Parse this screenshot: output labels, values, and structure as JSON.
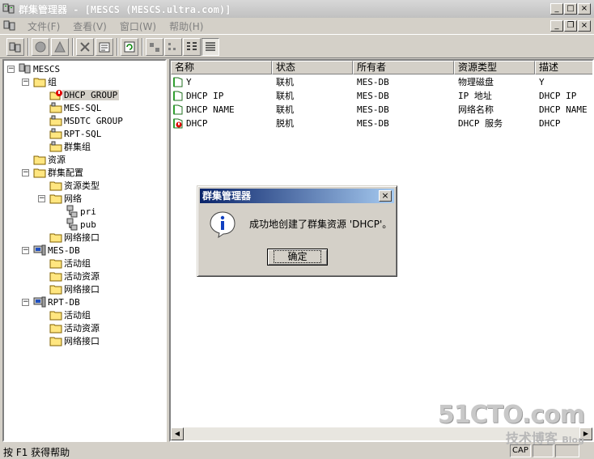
{
  "window": {
    "title": "群集管理器 - [MESCS (MESCS.ultra.com)]"
  },
  "menu": [
    "文件(F)",
    "查看(V)",
    "窗口(W)",
    "帮助(H)"
  ],
  "tree": {
    "root": "MESCS",
    "groups_label": "组",
    "groups": [
      "DHCP GROUP",
      "MES-SQL",
      "MSDTC GROUP",
      "RPT-SQL",
      "群集组"
    ],
    "resources_label": "资源",
    "cluster_config_label": "群集配置",
    "resource_types_label": "资源类型",
    "networks_label": "网络",
    "networks": [
      "pri",
      "pub"
    ],
    "network_interfaces_label": "网络接口",
    "nodes": [
      {
        "name": "MES-DB",
        "children": [
          "活动组",
          "活动资源",
          "网络接口"
        ]
      },
      {
        "name": "RPT-DB",
        "children": [
          "活动组",
          "活动资源",
          "网络接口"
        ]
      }
    ]
  },
  "list": {
    "columns": [
      "名称",
      "状态",
      "所有者",
      "资源类型",
      "描述"
    ],
    "rows": [
      {
        "name": "Y",
        "state": "联机",
        "owner": "MES-DB",
        "type": "物理磁盘",
        "desc": "Y"
      },
      {
        "name": "DHCP IP",
        "state": "联机",
        "owner": "MES-DB",
        "type": "IP 地址",
        "desc": "DHCP IP"
      },
      {
        "name": "DHCP NAME",
        "state": "联机",
        "owner": "MES-DB",
        "type": "网络名称",
        "desc": "DHCP NAME"
      },
      {
        "name": "DHCP",
        "state": "脱机",
        "owner": "MES-DB",
        "type": "DHCP 服务",
        "desc": "DHCP"
      }
    ]
  },
  "dialog": {
    "title": "群集管理器",
    "message": "成功地创建了群集资源 'DHCP'。",
    "ok_label": "确定"
  },
  "status": {
    "text": "按 F1 获得帮助",
    "cap": "CAP"
  },
  "watermark": {
    "main": "51CTO.com",
    "sub": "技术博客",
    "blog": "Blog"
  },
  "colors": {
    "dialog_title_start": "#0a246a",
    "dialog_title_end": "#a6caf0",
    "face": "#d4d0c8"
  }
}
